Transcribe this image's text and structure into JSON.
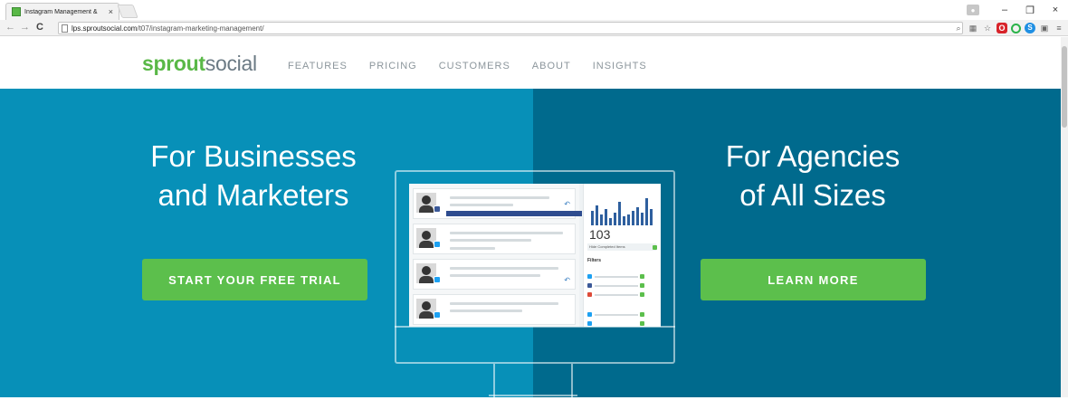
{
  "browser": {
    "tab_title": "Instagram Management &",
    "tab_close": "×",
    "url_host": "lps.sproutsocial.com",
    "url_path": "/t07/instagram-marketing-management/",
    "nav_back": "←",
    "nav_forward": "→",
    "nav_reload": "C",
    "window_minimize": "–",
    "window_restore": "❐",
    "window_close": "×",
    "menu_icon": "≡",
    "extension_icons": [
      "zoom-icon",
      "translate-icon",
      "bookmark-star-icon",
      "opera-extension-icon",
      "grammarly-icon",
      "skype-icon",
      "extension-icon"
    ]
  },
  "header": {
    "logo_bold": "sprout",
    "logo_light": "social",
    "nav": [
      "FEATURES",
      "PRICING",
      "CUSTOMERS",
      "ABOUT",
      "INSIGHTS"
    ]
  },
  "hero": {
    "left_heading_line1": "For Businesses",
    "left_heading_line2": "and Marketers",
    "left_cta": "START YOUR FREE TRIAL",
    "right_heading_line1": "For Agencies",
    "right_heading_line2": "of All Sizes",
    "right_cta": "LEARN MORE",
    "colors": {
      "left_bg": "#0790b8",
      "right_bg": "#006a8d",
      "cta_bg": "#5cbf4c",
      "logo_green": "#59b847"
    }
  },
  "illustration": {
    "count": "103",
    "hide_completed": "Hide Completed Items",
    "filters": "Filters"
  }
}
